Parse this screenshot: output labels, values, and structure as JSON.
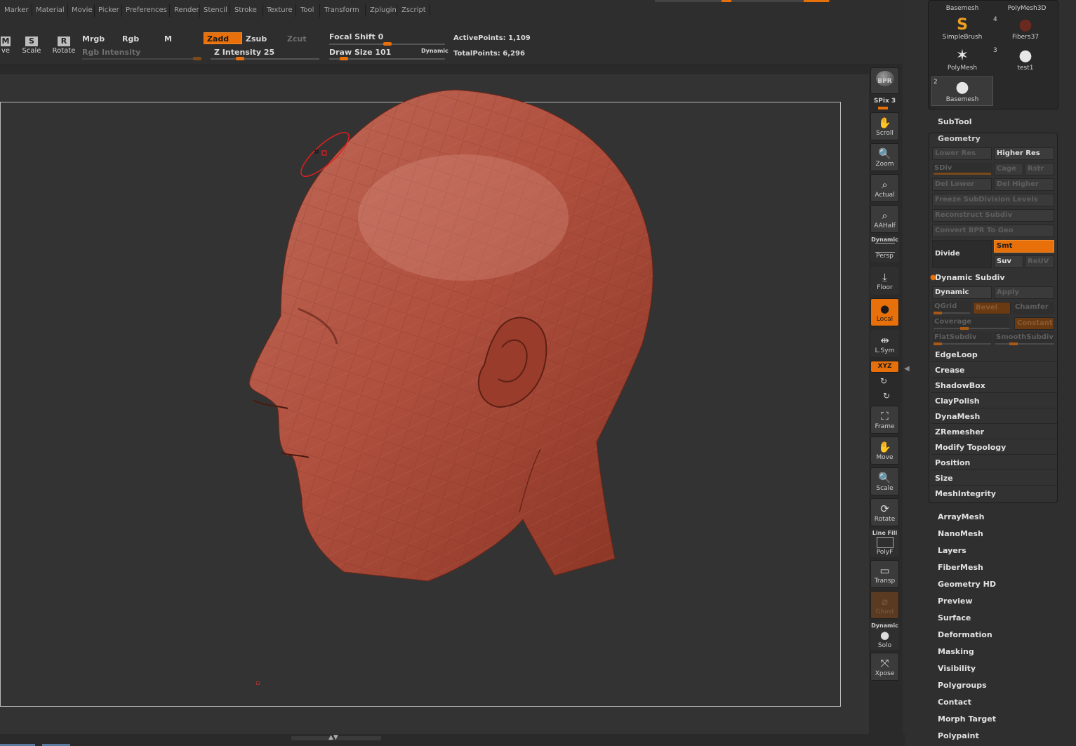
{
  "menu": [
    "Marker",
    "Material",
    "Movie",
    "Picker",
    "Preferences",
    "Render",
    "Stencil",
    "Stroke",
    "Texture",
    "Tool",
    "Transform",
    "Zplugin",
    "Zscript"
  ],
  "toolbar": {
    "move_label": "ve",
    "scale_label": "Scale",
    "rotate_label": "Rotate",
    "mrgb": "Mrgb",
    "rgb": "Rgb",
    "m": "M",
    "rgb_intensity": "Rgb Intensity",
    "zadd": "Zadd",
    "zsub": "Zsub",
    "zcut": "Zcut",
    "z_intensity": "Z Intensity 25",
    "focal_shift": "Focal Shift 0",
    "draw_size": "Draw Size 101",
    "dynamic": "Dynamic",
    "active_points": "ActivePoints: 1,109",
    "total_points": "TotalPoints: 6,296",
    "z_intensity_value": 25,
    "focal_shift_value": 0,
    "draw_size_value": 101
  },
  "shelf": {
    "bpr": "BPR",
    "spix": "SPix 3",
    "scroll": "Scroll",
    "zoom": "Zoom",
    "actual": "Actual",
    "aahalf": "AAHalf",
    "dynamic_top": "Dynamic",
    "persp": "Persp",
    "floor": "Floor",
    "local": "Local",
    "lsym": "L.Sym",
    "xyz": "XYZ",
    "frame": "Frame",
    "move": "Move",
    "scale": "Scale",
    "rotate": "Rotate",
    "line_fill": "Line Fill",
    "polyf": "PolyF",
    "transp": "Transp",
    "ghost": "Ghost",
    "dynamic_solo": "Dynamic",
    "solo": "Solo",
    "xpose": "Xpose"
  },
  "tools": {
    "basemesh_top": "Basemesh",
    "polymesh3d": "PolyMesh3D",
    "simplebrush": "SimpleBrush",
    "fibers37": "Fibers37",
    "fibers_num": "4",
    "polymesh": "PolyMesh",
    "test1": "test1",
    "test1_num": "3",
    "basemesh": "Basemesh",
    "basemesh_num": "2"
  },
  "subtool": "SubTool",
  "geometry": {
    "title": "Geometry",
    "lower_res": "Lower Res",
    "higher_res": "Higher Res",
    "sdiv": "SDiv",
    "cage": "Cage",
    "rstr": "Rstr",
    "del_lower": "Del Lower",
    "del_higher": "Del Higher",
    "freeze": "Freeze SubDivision Levels",
    "reconstruct": "Reconstruct Subdiv",
    "convert_bpr": "Convert BPR To Geo",
    "divide": "Divide",
    "smt": "Smt",
    "suv": "Suv",
    "reuv": "ReUV",
    "dynamic_subdiv": "Dynamic Subdiv",
    "dynamic": "Dynamic",
    "apply": "Apply",
    "qgrid": "QGrid",
    "bevel": "Bevel",
    "chamfer": "Chamfer",
    "coverage": "Coverage",
    "constant": "Constant",
    "flatsubdiv": "FlatSubdiv",
    "smoothsubdiv": "SmoothSubdiv",
    "items": [
      "EdgeLoop",
      "Crease",
      "ShadowBox",
      "ClayPolish",
      "DynaMesh",
      "ZRemesher",
      "Modify Topology",
      "Position",
      "Size",
      "MeshIntegrity"
    ]
  },
  "sections": [
    "ArrayMesh",
    "NanoMesh",
    "Layers",
    "FiberMesh",
    "Geometry HD",
    "Preview",
    "Surface",
    "Deformation",
    "Masking",
    "Visibility",
    "Polygroups",
    "Contact",
    "Morph Target",
    "Polypaint"
  ],
  "colors": {
    "accent": "#e8700a",
    "model": "#b85040",
    "bg": "#2a2a2a"
  }
}
